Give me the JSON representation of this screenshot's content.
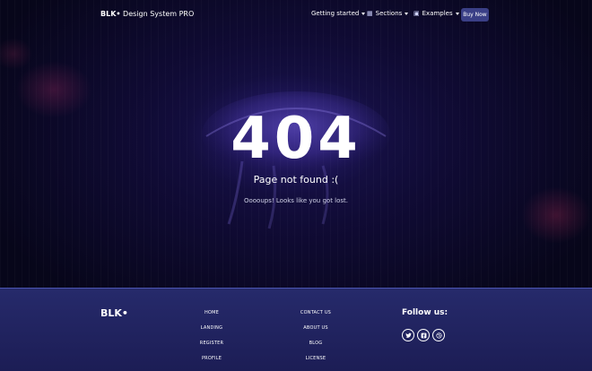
{
  "navbar": {
    "brand_bold": "BLK•",
    "brand_rest": " Design System PRO",
    "items": [
      {
        "label": "Getting started",
        "icon": ""
      },
      {
        "label": "Sections",
        "icon": "layout-icon"
      },
      {
        "label": "Examples",
        "icon": "document-icon"
      }
    ],
    "buy_label": "Buy Now"
  },
  "error": {
    "code": "404",
    "title": "Page not found :(",
    "message": "Ooooups! Looks like you got lost."
  },
  "footer": {
    "brand": "BLK•",
    "col1": [
      "HOME",
      "LANDING",
      "REGISTER",
      "PROFILE"
    ],
    "col2": [
      "CONTACT US",
      "ABOUT US",
      "BLOG",
      "LICENSE"
    ],
    "follow_label": "Follow us:",
    "social": [
      "twitter-icon",
      "facebook-icon",
      "dribbble-icon"
    ]
  },
  "colors": {
    "background": "#0b0b1f",
    "footer": "#262a6b",
    "button": "#3a3f86",
    "footer_border": "#4b55b0"
  }
}
